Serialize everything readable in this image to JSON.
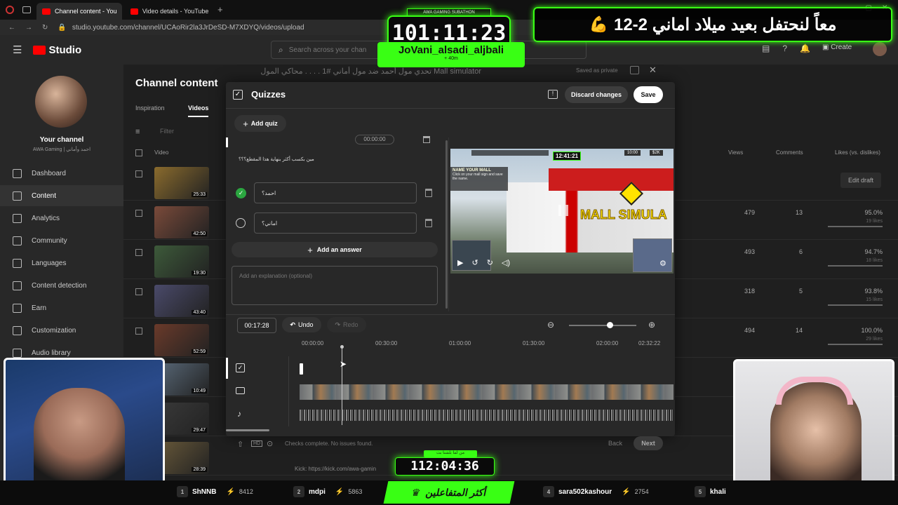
{
  "browser": {
    "tabs": [
      {
        "label": "Channel content - You"
      },
      {
        "label": "Video details - YouTube St"
      }
    ],
    "url": "studio.youtube.com/channel/UCAoRir2la3JrDeSD-M7XDYQ/videos/upload"
  },
  "studio": {
    "logo_label": "Studio",
    "search_placeholder": "Search across your chan",
    "channel_name": "Your channel",
    "channel_handle": "AWA Gaming | احمد وأماني",
    "nav": [
      {
        "label": "Dashboard",
        "icon": "dashboard-icon"
      },
      {
        "label": "Content",
        "icon": "content-icon"
      },
      {
        "label": "Analytics",
        "icon": "analytics-icon"
      },
      {
        "label": "Community",
        "icon": "community-icon"
      },
      {
        "label": "Languages",
        "icon": "languages-icon"
      },
      {
        "label": "Content detection",
        "icon": "copyright-icon"
      },
      {
        "label": "Earn",
        "icon": "earn-icon"
      },
      {
        "label": "Customization",
        "icon": "customization-icon"
      },
      {
        "label": "Audio library",
        "icon": "audio-library-icon"
      }
    ],
    "page_title": "Channel content",
    "tabs": [
      "Inspiration",
      "Videos"
    ],
    "filter_placeholder": "Filter",
    "columns": {
      "video": "Video",
      "views": "Views",
      "comments": "Comments",
      "likes": "Likes (vs. dislikes)"
    },
    "rows": [
      {
        "duration": "25:33",
        "views": "",
        "comments": "",
        "likes_pct": "",
        "likes_count": "",
        "action": "Edit draft",
        "thumb_color": "#8a6b2d"
      },
      {
        "duration": "42:50",
        "views": "479",
        "comments": "13",
        "likes_pct": "95.0%",
        "likes_count": "19 likes",
        "action": "",
        "thumb_color": "#7a4a3a"
      },
      {
        "duration": "19:30",
        "views": "493",
        "comments": "6",
        "likes_pct": "94.7%",
        "likes_count": "18 likes",
        "action": "",
        "thumb_color": "#3d5a3a"
      },
      {
        "duration": "43:40",
        "views": "318",
        "comments": "5",
        "likes_pct": "93.8%",
        "likes_count": "15 likes",
        "action": "",
        "thumb_color": "#4a4a6a"
      },
      {
        "duration": "52:59",
        "views": "494",
        "comments": "14",
        "likes_pct": "100.0%",
        "likes_count": "29 likes",
        "action": "",
        "thumb_color": "#6a3a2a"
      },
      {
        "duration": "10:49",
        "views": "",
        "comments": "",
        "likes_pct": "",
        "likes_count": "",
        "action": "",
        "thumb_color": "#5a6a7a"
      },
      {
        "duration": "29:47",
        "views": "",
        "comments": "",
        "likes_pct": "",
        "likes_count": "",
        "action": "",
        "thumb_color": "#3a3a3a"
      },
      {
        "duration": "28:39",
        "views": "",
        "comments": "",
        "likes_pct": "",
        "likes_count": "",
        "action": "",
        "thumb_color": "#6a5a3a"
      }
    ]
  },
  "video_details": {
    "title": "Mall simulator تحدي مول أحمد ضد مول أماني #1 . . . . محاكي المول",
    "saved_status": "Saved as private"
  },
  "quizzes": {
    "title": "Quizzes",
    "discard_label": "Discard changes",
    "save_label": "Save",
    "add_quiz_label": "Add quiz",
    "collapsed_time": "00:00:00",
    "question": "مين بكسب أكثر بنهاية هذا المقطع؟؟؟",
    "answers": [
      {
        "text": "احمد؟",
        "correct": true
      },
      {
        "text": "اماني؟",
        "correct": false
      }
    ],
    "add_answer_label": "Add an answer",
    "explanation_placeholder": "Add an explanation (optional)",
    "current_time": "00:17:28",
    "undo_label": "Undo",
    "redo_label": "Redo",
    "zoom_level": 0.6,
    "timeline_marks": [
      "00:00:00",
      "00:30:00",
      "01:00:00",
      "01:30:00",
      "02:00:00",
      "02:32:22"
    ],
    "footer_status": "Checks complete. No issues found.",
    "back_label": "Back",
    "next_label": "Next",
    "preview": {
      "name_mall_title": "NAME YOUR MALL",
      "name_mall_text": "Click on your mall sign and save the name.",
      "game_clock": "12:41:21",
      "hud_time": "10:00",
      "hud_money": "$2K",
      "sign_text": "MALL SIMULA"
    }
  },
  "overlays": {
    "subathon_label": "AWA GAMING SUBATHON",
    "subathon_timer": "101:11:23",
    "donor_name": "JoVani_alsadi_aljbali",
    "donor_added": "+ 40m",
    "banner_text": "معاً لنحتفل بعيد ميلاد اماني 2-12",
    "banner_emoji": "💪",
    "countdown_label": "من لما بلشنا بث",
    "countdown_timer": "112:04:36",
    "top_label": "أكثر المتفاعلين",
    "leaders": [
      {
        "rank": "1",
        "name": "ShNNB",
        "points": "8412"
      },
      {
        "rank": "2",
        "name": "mdpi",
        "points": "5863"
      },
      {
        "rank": "4",
        "name": "sara502kashour",
        "points": "2754"
      },
      {
        "rank": "5",
        "name": "khali",
        "points": ""
      }
    ],
    "ticker_text": "Kick: https://kick.com/awa-gamin"
  },
  "colors": {
    "accent_green": "#39ff14",
    "youtube_red": "#ff0000",
    "checked_green": "#2ba640"
  }
}
